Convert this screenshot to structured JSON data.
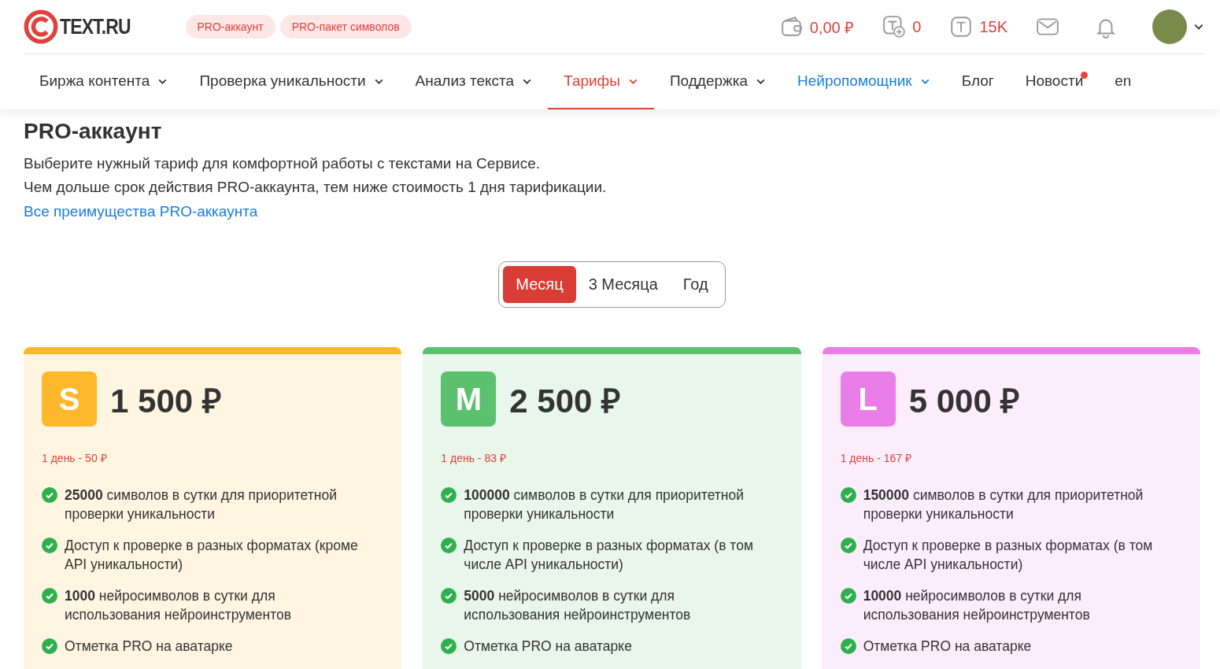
{
  "header": {
    "logo": "TEXT.RU",
    "pills": [
      "PRO-аккаунт",
      "PRO-пакет символов"
    ],
    "stats": [
      {
        "kind": "wallet",
        "value": "0,00 ₽"
      },
      {
        "kind": "tplus",
        "value": "0"
      },
      {
        "kind": "t",
        "value": "15K"
      }
    ]
  },
  "nav": [
    {
      "label": "Биржа контента",
      "dropdown": true,
      "selected": false,
      "kind": "normal",
      "dot": false
    },
    {
      "label": "Проверка уникальности",
      "dropdown": true,
      "selected": false,
      "kind": "normal",
      "dot": false
    },
    {
      "label": "Анализ текста",
      "dropdown": true,
      "selected": false,
      "kind": "normal",
      "dot": false
    },
    {
      "label": "Тарифы",
      "dropdown": true,
      "selected": true,
      "kind": "normal",
      "dot": false
    },
    {
      "label": "Поддержка",
      "dropdown": true,
      "selected": false,
      "kind": "normal",
      "dot": false
    },
    {
      "label": "Нейропомощник",
      "dropdown": true,
      "selected": false,
      "kind": "ai",
      "dot": false
    },
    {
      "label": "Блог",
      "dropdown": false,
      "selected": false,
      "kind": "normal",
      "dot": false
    },
    {
      "label": "Новости",
      "dropdown": false,
      "selected": false,
      "kind": "normal",
      "dot": true
    },
    {
      "label": "en",
      "dropdown": false,
      "selected": false,
      "kind": "normal",
      "dot": false
    }
  ],
  "page": {
    "title": "PRO-аккаунт",
    "lines": [
      "Выберите нужный тариф для комфортной работы с текстами на Сервисе.",
      "Чем дольше срок действия PRO-аккаунта, тем ниже стоимость 1 дня тарификации."
    ],
    "link": "Все преимущества PRO-аккаунта"
  },
  "periods": [
    {
      "label": "Месяц",
      "selected": true
    },
    {
      "label": "3 Месяца",
      "selected": false
    },
    {
      "label": "Год",
      "selected": false
    }
  ],
  "plans": [
    {
      "letter": "S",
      "price": "1 500 ₽",
      "per_day": "1 день - 50 ₽",
      "color": "#ffb72c",
      "features": [
        "**25000** символов в сутки для приоритетной проверки уникальности",
        "Доступ к проверке в разных форматах (кроме API уникальности)",
        "**1000** нейросимволов в сутки для использования нейроинструментов",
        "Отметка PRO на аватарке"
      ]
    },
    {
      "letter": "M",
      "price": "2 500 ₽",
      "per_day": "1 день - 83 ₽",
      "color": "#5cc16f",
      "features": [
        "**100000** символов в сутки для приоритетной проверки уникальности",
        "Доступ к проверке в разных форматах (в том числе API уникальности)",
        "**5000** нейросимволов в сутки для использования нейроинструментов",
        "Отметка PRO на аватарке"
      ]
    },
    {
      "letter": "L",
      "price": "5 000 ₽",
      "per_day": "1 день - 167 ₽",
      "color": "#ea7ee8",
      "features": [
        "**150000** символов в сутки для приоритетной проверки уникальности",
        "Доступ к проверке в разных форматах (в том числе API уникальности)",
        "**10000** нейросимволов в сутки для использования нейроинструментов",
        "Отметка PRO на аватарке"
      ]
    }
  ]
}
